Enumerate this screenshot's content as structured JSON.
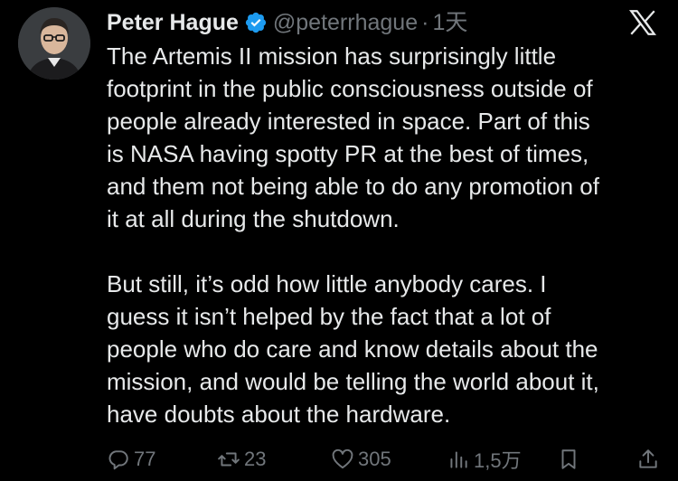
{
  "author": {
    "name": "Peter Hague",
    "handle": "@peterrhague",
    "separator": "·",
    "time": "1天",
    "verified": true
  },
  "icons": {
    "avatar": "profile-photo",
    "verified": "verified-badge-icon",
    "logo": "x-logo-icon",
    "reply": "reply-icon",
    "repost": "repost-icon",
    "like": "heart-icon",
    "views": "views-icon",
    "bookmark": "bookmark-icon",
    "share": "share-icon"
  },
  "colors": {
    "background": "#000000",
    "text": "#e7e9ea",
    "muted": "#71767b",
    "verified": "#1d9bf0"
  },
  "tweet": {
    "paragraph1": "The Artemis II mission has surprisingly little\nfootprint in the public consciousness outside of\npeople already interested in space. Part of this\nis NASA having spotty PR at the best of times,\nand them not being able to do any promotion of\nit at all during the shutdown.",
    "paragraph2": "But still, it’s odd how little anybody cares. I\nguess it isn’t helped by the fact that a lot of\npeople who do care and know details about the\nmission, and would be telling the world about it,\nhave doubts about the hardware."
  },
  "actions": {
    "replies": "77",
    "reposts": "23",
    "likes": "305",
    "views": "1,5万"
  }
}
